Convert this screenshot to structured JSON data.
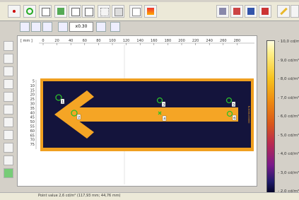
{
  "toolbar": {
    "zoom_value": "x0.30",
    "units_label": "[ mm ]"
  },
  "ruler": {
    "x_ticks": [
      "0",
      "20",
      "40",
      "60",
      "80",
      "100",
      "120",
      "140",
      "160",
      "180",
      "200",
      "220",
      "240",
      "260",
      "280"
    ],
    "y_ticks": [
      "5",
      "10",
      "15",
      "20",
      "25",
      "30",
      "35",
      "40",
      "45",
      "50",
      "55",
      "60",
      "65",
      "70",
      "75"
    ]
  },
  "colorbar": {
    "labels": [
      "10,0 cd/m²",
      "9,0 cd/m²",
      "8,0 cd/m²",
      "7,0 cd/m²",
      "6,0 cd/m²",
      "5,0 cd/m²",
      "4,0 cd/m²",
      "3,0 cd/m²",
      "2,0 cd/m²"
    ]
  },
  "markers": {
    "labels": [
      "1",
      "2",
      "3",
      "4",
      "5",
      "6",
      "7"
    ]
  },
  "sign": {
    "side_text": "R-3000-00000"
  },
  "status": {
    "text": "Point value 2,6 cd/m² (117,93 mm; 44,76 mm)"
  },
  "colors": {
    "sign_orange": "#f0a020",
    "sign_dark": "#14143c",
    "marker_green": "#2bbf2b"
  }
}
